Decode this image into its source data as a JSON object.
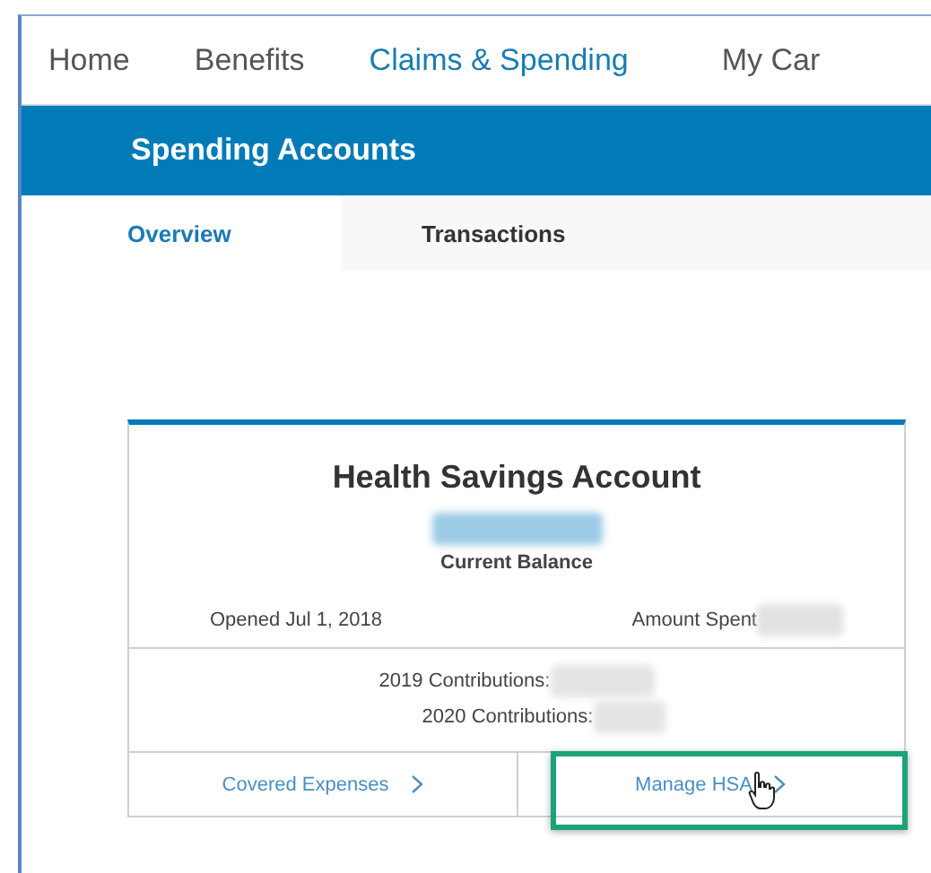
{
  "nav": [
    {
      "label": "Home",
      "selected": false
    },
    {
      "label": "Benefits",
      "selected": false
    },
    {
      "label": "Claims & Spending",
      "selected": true
    },
    {
      "label": "My Car",
      "selected": false
    }
  ],
  "section_title": "Spending Accounts",
  "tabs": [
    {
      "label": "Overview",
      "selected": true
    },
    {
      "label": "Transactions",
      "selected": false
    }
  ],
  "card": {
    "title": "Health Savings Account",
    "balance_label": "Current Balance",
    "opened": "Opened Jul 1, 2018",
    "amount_spent_label": "Amount Spent",
    "contributions": [
      "2019 Contributions:",
      "2020 Contributions:"
    ],
    "links": [
      {
        "label": "Covered Expenses",
        "highlighted": false
      },
      {
        "label": "Manage HSA",
        "highlighted": true
      }
    ]
  }
}
